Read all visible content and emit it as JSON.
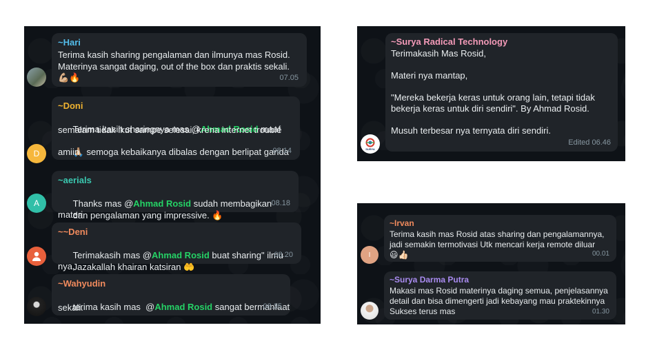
{
  "left_chat": {
    "messages": [
      {
        "sender": "~Hari",
        "sender_color": "#53bdeb",
        "line1": "Terima kasih sharing pengalaman dan ilmunya mas Rosid.",
        "line2": "Materinya sangat daging, out of the box dan praktis sekali.",
        "emoji": "💪🏼🔥",
        "time": "07.05",
        "avatar": "photo"
      },
      {
        "sender": "~Doni",
        "sender_color": "#f0b330",
        "pre": "Terima kasih sharingnya mas @",
        "mention": "Ahmad Rosid",
        "post": " maaf",
        "line2": "semalam tidak ikut sampe selesai, krena internet trouble",
        "emoji": "🙏🏼",
        "line3": " semoga kebaikanya dibalas dengan berlipat ganda",
        "line4": "amiin",
        "time": "08.14",
        "avatar_letter": "D",
        "avatar_color": "#f6b73c"
      },
      {
        "sender": "~aerials",
        "sender_color": "#3bc8b0",
        "pre": "Thanks mas @",
        "mention": "Ahmad Rosid",
        "post": " sudah membagikan materi",
        "line2": "dan pengalaman yang impressive. ",
        "emoji": "🔥",
        "time": "08.18",
        "avatar_letter": "A",
        "avatar_color": "#31bfa8"
      },
      {
        "sender": "~~Deni",
        "sender_color": "#f08a5d",
        "pre": "Terimakasih mas @",
        "mention": "Ahmad Rosid",
        "post": " buat sharing\" ilmu nya,",
        "line2": "Jazakallah khairan katsiran ",
        "emoji": "🤲",
        "time": "08.20",
        "avatar": "person-icon",
        "avatar_color": "#e8603c"
      },
      {
        "sender": "~Wahyudin",
        "sender_color": "#f08a5d",
        "pre": "terima kasih mas  @",
        "mention": "Ahmad Rosid",
        "post": " sangat bermanfaat",
        "line2": "sekali.",
        "time": "08.35",
        "avatar": "photo"
      }
    ]
  },
  "top_right_chat": {
    "sender": "~Surya Radical Technology",
    "sender_color": "#f39ab8",
    "lines": [
      "Terimakasih Mas Rosid,",
      "",
      "Materi nya mantap,",
      "",
      "\"Mereka bekerja keras untuk orang lain, tetapi tidak",
      "bekerja keras untuk diri sendiri\". By Ahmad Rosid.",
      "",
      "Musuh terbesar nya ternyata diri sendiri."
    ],
    "time": "Edited  06.46",
    "avatar_label": "SURYA"
  },
  "bottom_right_chat": {
    "messages": [
      {
        "sender": "~Irvan",
        "sender_color": "#f08a5d",
        "line1": "Terima kasih mas Rosid atas sharing dan pengalamannya,",
        "line2": "jadi semakin termotivasi Utk mencari kerja remote diluar",
        "emoji": "😃👍🏻",
        "time": "00.01",
        "avatar_letter": "I",
        "avatar_color": "#e0a383"
      },
      {
        "sender": "~Surya Darma Putra",
        "sender_color": "#a98bf0",
        "line1": "Makasi mas Rosid materinya daging semua, penjelasannya",
        "line2": "detail dan bisa dimengerti jadi kebayang mau praktekinnya",
        "line3": "Sukses terus mas",
        "time": "01.30",
        "avatar": "photo"
      }
    ]
  }
}
